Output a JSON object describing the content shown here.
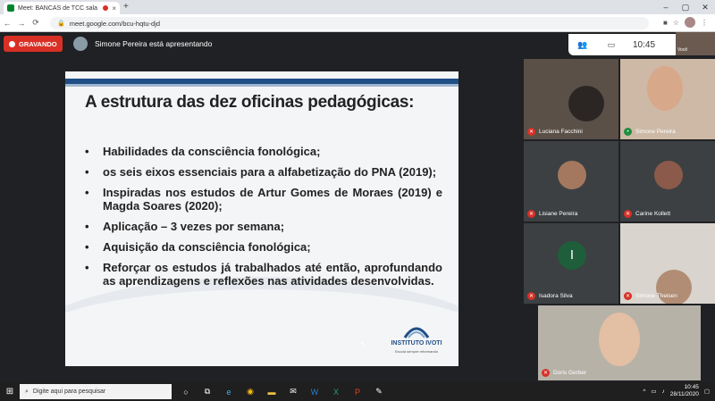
{
  "browser": {
    "tab_title": "Meet: BANCAS de TCC sala",
    "tab_close": "×",
    "new_tab": "+",
    "url": "meet.google.com/bcu-hqtu-djd",
    "win_min": "–",
    "win_max": "▢",
    "win_close": "✕"
  },
  "meet": {
    "recording_label": "GRAVANDO",
    "presenter_text": "Simone Pereira está apresentando",
    "clock": "10:45",
    "self_label": "Você"
  },
  "slide": {
    "title": "A estrutura das dez oficinas pedagógicas:",
    "bullet_char": "•",
    "bullets": [
      "Habilidades da consciência fonológica;",
      "os seis eixos essenciais para a alfabetização do PNA (2019);",
      "Inspiradas nos estudos de Artur Gomes de Moraes (2019) e Magda Soares (2020);",
      "Aplicação – 3 vezes por semana;",
      "Aquisição da consciência fonológica;",
      "Reforçar os estudos já trabalhados até então, aprofundando as aprendizagens e reflexões nas atividades desenvolvidas."
    ],
    "logo_name": "INSTITUTO IVOTI",
    "logo_tagline": "Escola sempre reformando"
  },
  "participants": [
    {
      "name": "Luciana Facchini"
    },
    {
      "name": "Simone Pereira"
    },
    {
      "name": "Lisiane Pereira"
    },
    {
      "name": "Carine Kollett"
    },
    {
      "name": "Isadora Silva",
      "initial": "I"
    },
    {
      "name": "Simone Theisen"
    },
    {
      "name": "Doris Gerber"
    }
  ],
  "taskbar": {
    "search_placeholder": "Digite aqui para pesquisar",
    "time": "10:45",
    "date": "28/11/2020"
  }
}
